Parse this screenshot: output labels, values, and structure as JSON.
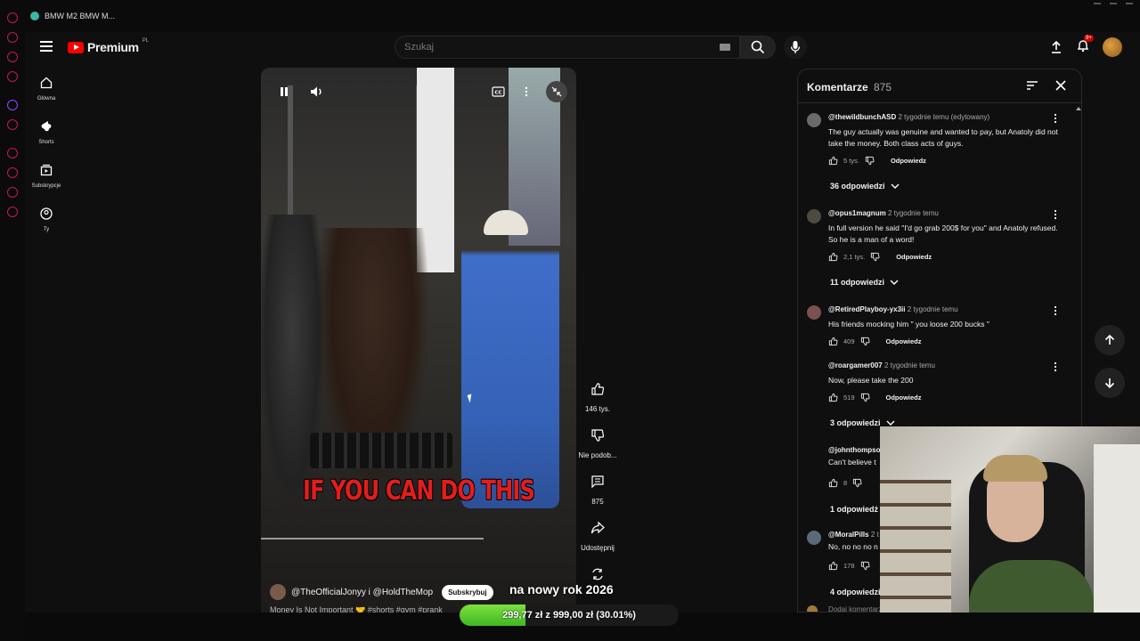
{
  "browser": {
    "tab_title": "BMW M2 BMW M..."
  },
  "header": {
    "logo_text": "Premium",
    "logo_region": "PL",
    "search_placeholder": "Szukaj",
    "notifications_badge": "9+"
  },
  "sidebar": {
    "items": [
      {
        "label": "Główna",
        "icon": "home-icon"
      },
      {
        "label": "Shorts",
        "icon": "shorts-icon"
      },
      {
        "label": "Subskrypcje",
        "icon": "subscriptions-icon"
      },
      {
        "label": "Ty",
        "icon": "user-icon"
      }
    ]
  },
  "video": {
    "caption": "IF YOU CAN DO THIS",
    "channel": "@TheOfficialJonyy i @HoldTheMop",
    "subscribe_label": "Subskrybuj",
    "description": "Money Is Not Important 🤝 #shorts #gym #prank"
  },
  "actions": {
    "like_count": "146 tys.",
    "dislike_label": "Nie podob...",
    "comments_count": "875",
    "share_label": "Udostępnij"
  },
  "comments": {
    "title": "Komentarze",
    "count": "875",
    "reply_label": "Odpowiedz",
    "items": [
      {
        "user": "@thewildbunchASD",
        "time": "2 tygodnie temu (edytowany)",
        "text": "The guy actually was genuine and wanted to pay, but Anatoly did not take the money. Both class acts of guys.",
        "likes": "5 tys.",
        "replies": "36 odpowiedzi"
      },
      {
        "user": "@opus1magnum",
        "time": "2 tygodnie temu",
        "text": "In full version he said \"I'd go grab 200$ for you\" and Anatoly refused. So he is a man of a word!",
        "likes": "2,1 tys.",
        "replies": "11 odpowiedzi"
      },
      {
        "user": "@RetiredPlayboy-yx3ii",
        "time": "2 tygodnie temu",
        "text": "His friends mocking him \" you loose 200 bucks \"",
        "likes": "409",
        "replies": ""
      },
      {
        "user": "@roargamer007",
        "time": "2 tygodnie temu",
        "text": "Now, please take the 200",
        "likes": "519",
        "replies": "3 odpowiedzi"
      },
      {
        "user": "@johnthompso",
        "time": "",
        "text": "Can't believe t",
        "likes": "8",
        "replies": "1 odpowiedź"
      },
      {
        "user": "@MoralPills",
        "time": "2 t",
        "text": "No, no no no n",
        "likes": "178",
        "replies": "4 odpowiedzi"
      }
    ],
    "add_comment_placeholder": "Dodaj komentarz..."
  },
  "donation": {
    "title": "na nowy rok 2026",
    "progress_text": "299,77 zł z 999,00 zł (30.01%)",
    "progress_fraction": 0.3001
  },
  "colors": {
    "accent_red": "#ff0000",
    "donation_green": "#5ccd2e",
    "caption_red": "#e11d1d"
  }
}
